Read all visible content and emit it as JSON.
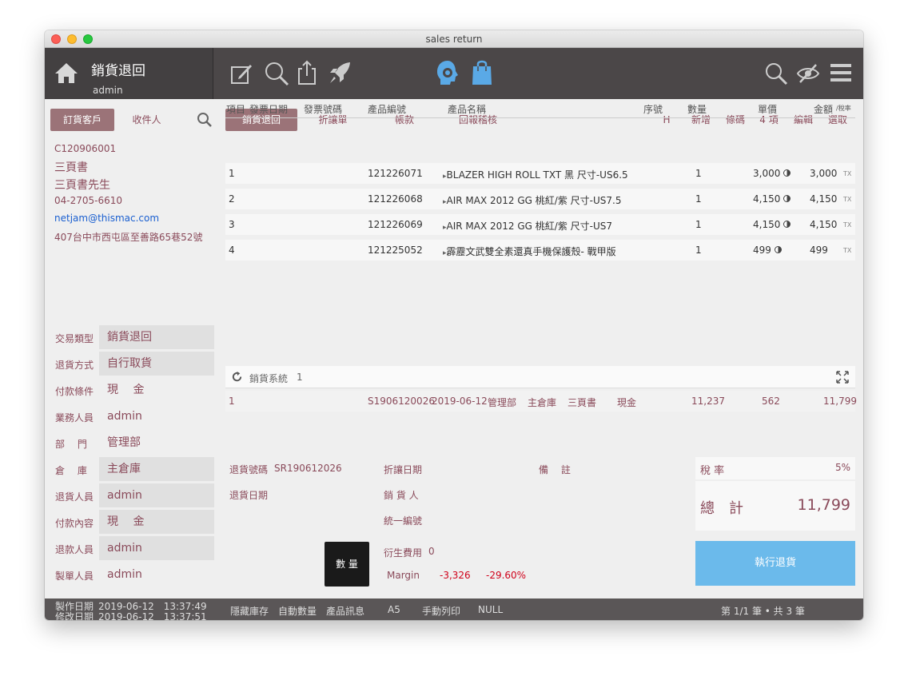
{
  "window": {
    "title": "sales return"
  },
  "app": {
    "title": "銷貨退回",
    "user": "admin"
  },
  "customer": {
    "tabs": [
      "訂貨客戶",
      "收件人"
    ],
    "id": "C120906001",
    "company": "三頁書",
    "contact": "三頁書先生",
    "phone": "04-2705-6610",
    "email": "netjam@thismac.com",
    "address": "407台中市西屯區至善路65巷52號"
  },
  "fields": [
    {
      "label": "交易類型",
      "value": "銷貨退回",
      "box": true
    },
    {
      "label": "退貨方式",
      "value": "自行取貨",
      "box": true
    },
    {
      "label": "付款條件",
      "value": "現　 金",
      "box": false
    },
    {
      "label": "業務人員",
      "value": "admin",
      "box": false
    },
    {
      "label": "部　 門",
      "value": "管理部",
      "box": false
    },
    {
      "label": "倉　 庫",
      "value": "主倉庫",
      "box": true
    },
    {
      "label": "退貨人員",
      "value": "admin",
      "box": true
    },
    {
      "label": "付款內容",
      "value": "現　 金",
      "box": true
    },
    {
      "label": "退款人員",
      "value": "admin",
      "box": true
    },
    {
      "label": "製單人員",
      "value": "admin",
      "box": false
    }
  ],
  "tabs": [
    "銷貨退回",
    "折讓單",
    "帳款",
    "回報稽核"
  ],
  "actions": [
    "H",
    "新增",
    "條碼",
    "4 項",
    "編輯",
    "選取"
  ],
  "columns": {
    "item": "項目",
    "invoice_date": "發票日期",
    "invoice_no": "發票號碼",
    "code": "產品編號",
    "name": "產品名稱",
    "serial": "序號",
    "qty": "數量",
    "price": "單價",
    "amount": "金額",
    "tax_label": "/稅率"
  },
  "rows": [
    {
      "item": "1",
      "code": "121226071",
      "name": "BLAZER HIGH ROLL TXT 黑 尺寸-US6.5",
      "qty": "1",
      "price": "3,000",
      "amount": "3,000",
      "tax": "TX"
    },
    {
      "item": "2",
      "code": "121226068",
      "name": "AIR MAX 2012 GG 桃紅/紫 尺寸-US7.5",
      "qty": "1",
      "price": "4,150",
      "amount": "4,150",
      "tax": "TX"
    },
    {
      "item": "3",
      "code": "121226069",
      "name": "AIR MAX 2012 GG 桃紅/紫 尺寸-US7",
      "qty": "1",
      "price": "4,150",
      "amount": "4,150",
      "tax": "TX"
    },
    {
      "item": "4",
      "code": "121225052",
      "name": "霹靂文武雙全素還真手機保護殼- 戰甲版",
      "qty": "1",
      "price": "499",
      "amount": "499",
      "tax": "TX"
    }
  ],
  "sales": {
    "label": "銷貨系統",
    "count": "1",
    "row": {
      "no": "1",
      "order": "S1906120026",
      "date": "2019-06-12",
      "dept": "管理部",
      "warehouse": "主倉庫",
      "customer": "三頁書",
      "payment": "現金",
      "subtotal": "11,237",
      "tax": "562",
      "total": "11,799"
    }
  },
  "footer": {
    "return_no_label": "退貨號碼",
    "return_no": "SR190612026",
    "return_date_label": "退貨日期",
    "discount_date_label": "折讓日期",
    "sales_person_label": "銷 貨 人",
    "tax_id_label": "統一編號",
    "note_label": "備　 註",
    "derived_label": "衍生費用",
    "derived_value": "0",
    "margin_label": "Margin",
    "margin_value": "-3,326",
    "margin_pct": "-29.60%",
    "qty_button": "數 量"
  },
  "totals": {
    "tax_label": "稅 率",
    "tax_rate": "5%",
    "total_label": "總　計",
    "total": "11,799",
    "execute": "執行退貨"
  },
  "status": {
    "created_label": "製作日期",
    "created": "2019-06-12　13:37:49",
    "modified_label": "修改日期",
    "modified": "2019-06-12　13:37:51",
    "items": [
      "隱藏庫存",
      "自動數量",
      "產品訊息",
      "A5",
      "手動列印",
      "NULL"
    ],
    "pages": "第 1/1 筆 • 共 3 筆"
  }
}
